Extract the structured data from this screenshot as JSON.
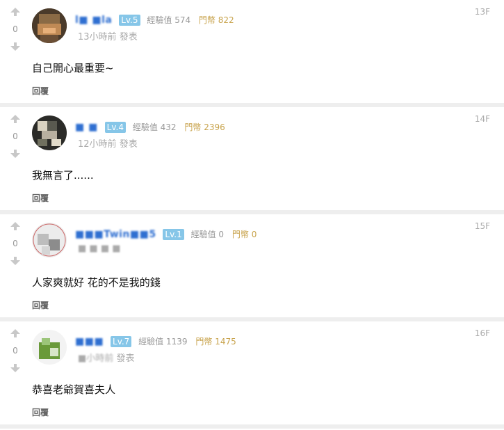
{
  "ui": {
    "reply_label": "回覆",
    "time_suffix": "發表",
    "exp_label": "經驗值",
    "coin_label": "門幣"
  },
  "comments": [
    {
      "floor": "13F",
      "score": "0",
      "username": "l■ ■la",
      "level": "Lv.5",
      "exp": "574",
      "coins": "822",
      "time": "13小時前",
      "content": "自己開心最重要~"
    },
    {
      "floor": "14F",
      "score": "0",
      "username": "■ ■",
      "level": "Lv.4",
      "exp": "432",
      "coins": "2396",
      "time": "12小時前",
      "content": "我無言了......"
    },
    {
      "floor": "15F",
      "score": "0",
      "username": "■■■Twin■■5",
      "level": "Lv.1",
      "exp": "0",
      "coins": "0",
      "time": "■ ■ ■ ■",
      "content": "人家爽就好 花的不是我的錢"
    },
    {
      "floor": "16F",
      "score": "0",
      "username": "■■■",
      "level": "Lv.7",
      "exp": "1139",
      "coins": "1475",
      "time": "■小時前",
      "content": "恭喜老爺賀喜夫人"
    }
  ]
}
